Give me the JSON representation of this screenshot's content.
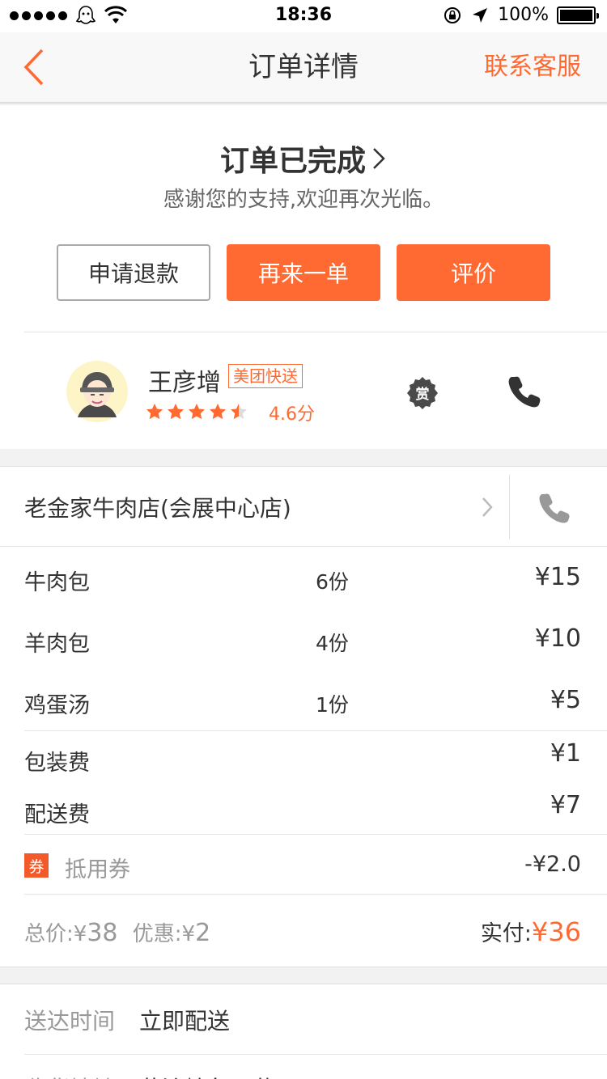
{
  "status_bar": {
    "time": "18:36",
    "battery_percent": "100%",
    "battery_level": 1.0
  },
  "nav": {
    "title": "订单详情",
    "contact": "联系客服",
    "back_icon": "chevron-left-icon"
  },
  "order_status": {
    "title": "订单已完成",
    "subtitle": "感谢您的支持,欢迎再次光临。",
    "buttons": {
      "refund": "申请退款",
      "reorder": "再来一单",
      "review": "评价"
    }
  },
  "courier": {
    "name": "王彦增",
    "tag": "美团快送",
    "stars": 4.5,
    "rating_text": "4.6分",
    "reward_icon_text": "赏",
    "accent": "#ff6a32"
  },
  "shop": {
    "name": "老金家牛肉店(会展中心店)",
    "items": [
      {
        "name": "牛肉包",
        "qty": "6份",
        "price": "¥15"
      },
      {
        "name": "羊肉包",
        "qty": "4份",
        "price": "¥10"
      },
      {
        "name": "鸡蛋汤",
        "qty": "1份",
        "price": "¥5"
      }
    ],
    "fees": [
      {
        "name": "包装费",
        "price": "¥1"
      },
      {
        "name": "配送费",
        "price": "¥7"
      }
    ],
    "coupon": {
      "badge": "券",
      "label": "抵用券",
      "amount": "-¥2.0"
    },
    "summary": {
      "total_label": "总价:",
      "total_currency": "¥",
      "total_value": "38",
      "discount_label": "优惠:",
      "discount_currency": "¥",
      "discount_value": "2",
      "paid_label": "实付:",
      "paid_value": "¥36"
    }
  },
  "delivery": {
    "time_label": "送达时间",
    "time_value": "立即配送",
    "addr_label": "收货地址",
    "addr_value": "黄沙岭角二巷"
  }
}
